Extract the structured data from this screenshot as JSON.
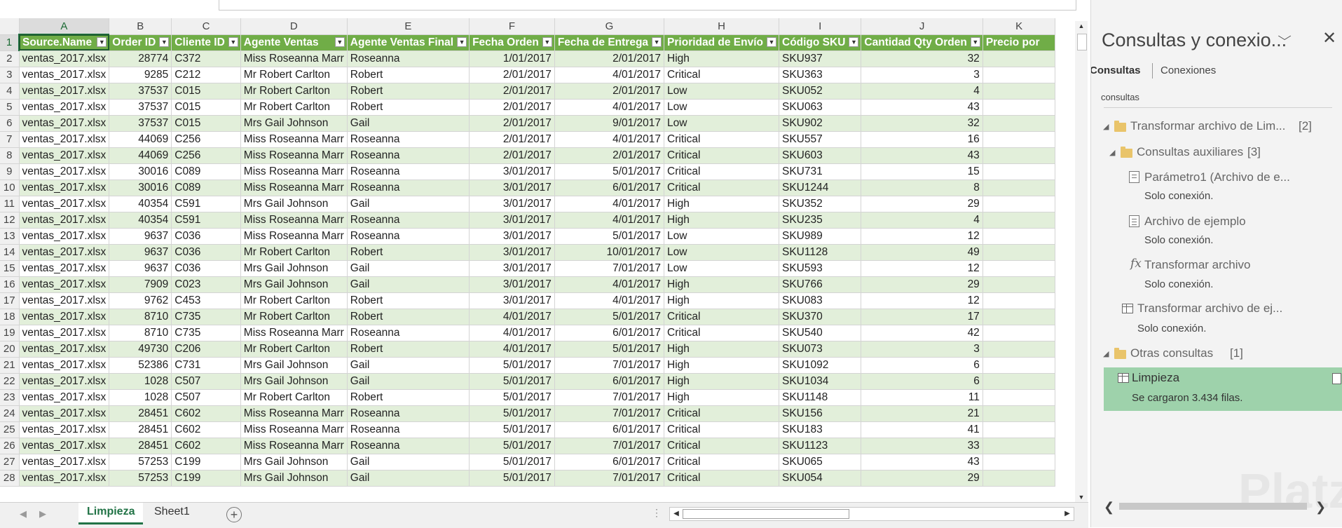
{
  "columns": [
    "A",
    "B",
    "C",
    "D",
    "E",
    "F",
    "G",
    "H",
    "I",
    "J",
    "K"
  ],
  "headers": [
    "Source.Name",
    "Order ID",
    "Cliente ID",
    "Agente Ventas",
    "Agente Ventas Final",
    "Fecha Orden",
    "Fecha de Entrega",
    "Prioridad de Envío",
    "Código SKU",
    "Cantidad Qty Orden",
    "Precio por"
  ],
  "rows": [
    [
      "ventas_2017.xlsx",
      "28774",
      "C372",
      "Miss Roseanna Marr",
      "Roseanna",
      "1/01/2017",
      "2/01/2017",
      "High",
      "SKU937",
      "32",
      ""
    ],
    [
      "ventas_2017.xlsx",
      "9285",
      "C212",
      "Mr Robert Carlton",
      "Robert",
      "2/01/2017",
      "4/01/2017",
      "Critical",
      "SKU363",
      "3",
      ""
    ],
    [
      "ventas_2017.xlsx",
      "37537",
      "C015",
      "Mr Robert Carlton",
      "Robert",
      "2/01/2017",
      "2/01/2017",
      "Low",
      "SKU052",
      "4",
      ""
    ],
    [
      "ventas_2017.xlsx",
      "37537",
      "C015",
      "Mr Robert Carlton",
      "Robert",
      "2/01/2017",
      "4/01/2017",
      "Low",
      "SKU063",
      "43",
      ""
    ],
    [
      "ventas_2017.xlsx",
      "37537",
      "C015",
      "Mrs Gail Johnson",
      "Gail",
      "2/01/2017",
      "9/01/2017",
      "Low",
      "SKU902",
      "32",
      ""
    ],
    [
      "ventas_2017.xlsx",
      "44069",
      "C256",
      "Miss Roseanna Marr",
      "Roseanna",
      "2/01/2017",
      "4/01/2017",
      "Critical",
      "SKU557",
      "16",
      ""
    ],
    [
      "ventas_2017.xlsx",
      "44069",
      "C256",
      "Miss Roseanna Marr",
      "Roseanna",
      "2/01/2017",
      "2/01/2017",
      "Critical",
      "SKU603",
      "43",
      ""
    ],
    [
      "ventas_2017.xlsx",
      "30016",
      "C089",
      "Miss Roseanna Marr",
      "Roseanna",
      "3/01/2017",
      "5/01/2017",
      "Critical",
      "SKU731",
      "15",
      ""
    ],
    [
      "ventas_2017.xlsx",
      "30016",
      "C089",
      "Miss Roseanna Marr",
      "Roseanna",
      "3/01/2017",
      "6/01/2017",
      "Critical",
      "SKU1244",
      "8",
      ""
    ],
    [
      "ventas_2017.xlsx",
      "40354",
      "C591",
      "Mrs Gail Johnson",
      "Gail",
      "3/01/2017",
      "4/01/2017",
      "High",
      "SKU352",
      "29",
      ""
    ],
    [
      "ventas_2017.xlsx",
      "40354",
      "C591",
      "Miss Roseanna Marr",
      "Roseanna",
      "3/01/2017",
      "4/01/2017",
      "High",
      "SKU235",
      "4",
      ""
    ],
    [
      "ventas_2017.xlsx",
      "9637",
      "C036",
      "Miss Roseanna Marr",
      "Roseanna",
      "3/01/2017",
      "5/01/2017",
      "Low",
      "SKU989",
      "12",
      ""
    ],
    [
      "ventas_2017.xlsx",
      "9637",
      "C036",
      "Mr Robert Carlton",
      "Robert",
      "3/01/2017",
      "10/01/2017",
      "Low",
      "SKU1128",
      "49",
      ""
    ],
    [
      "ventas_2017.xlsx",
      "9637",
      "C036",
      "Mrs Gail Johnson",
      "Gail",
      "3/01/2017",
      "7/01/2017",
      "Low",
      "SKU593",
      "12",
      ""
    ],
    [
      "ventas_2017.xlsx",
      "7909",
      "C023",
      "Mrs Gail Johnson",
      "Gail",
      "3/01/2017",
      "4/01/2017",
      "High",
      "SKU766",
      "29",
      ""
    ],
    [
      "ventas_2017.xlsx",
      "9762",
      "C453",
      "Mr Robert Carlton",
      "Robert",
      "3/01/2017",
      "4/01/2017",
      "High",
      "SKU083",
      "12",
      ""
    ],
    [
      "ventas_2017.xlsx",
      "8710",
      "C735",
      "Mr Robert Carlton",
      "Robert",
      "4/01/2017",
      "5/01/2017",
      "Critical",
      "SKU370",
      "17",
      ""
    ],
    [
      "ventas_2017.xlsx",
      "8710",
      "C735",
      "Miss Roseanna Marr",
      "Roseanna",
      "4/01/2017",
      "6/01/2017",
      "Critical",
      "SKU540",
      "42",
      ""
    ],
    [
      "ventas_2017.xlsx",
      "49730",
      "C206",
      "Mr Robert Carlton",
      "Robert",
      "4/01/2017",
      "5/01/2017",
      "High",
      "SKU073",
      "3",
      ""
    ],
    [
      "ventas_2017.xlsx",
      "52386",
      "C731",
      "Mrs Gail Johnson",
      "Gail",
      "5/01/2017",
      "7/01/2017",
      "High",
      "SKU1092",
      "6",
      ""
    ],
    [
      "ventas_2017.xlsx",
      "1028",
      "C507",
      "Mrs Gail Johnson",
      "Gail",
      "5/01/2017",
      "6/01/2017",
      "High",
      "SKU1034",
      "6",
      ""
    ],
    [
      "ventas_2017.xlsx",
      "1028",
      "C507",
      "Mr Robert Carlton",
      "Robert",
      "5/01/2017",
      "7/01/2017",
      "High",
      "SKU1148",
      "11",
      ""
    ],
    [
      "ventas_2017.xlsx",
      "28451",
      "C602",
      "Miss Roseanna Marr",
      "Roseanna",
      "5/01/2017",
      "7/01/2017",
      "Critical",
      "SKU156",
      "21",
      ""
    ],
    [
      "ventas_2017.xlsx",
      "28451",
      "C602",
      "Miss Roseanna Marr",
      "Roseanna",
      "5/01/2017",
      "6/01/2017",
      "Critical",
      "SKU183",
      "41",
      ""
    ],
    [
      "ventas_2017.xlsx",
      "28451",
      "C602",
      "Miss Roseanna Marr",
      "Roseanna",
      "5/01/2017",
      "7/01/2017",
      "Critical",
      "SKU1123",
      "33",
      ""
    ],
    [
      "ventas_2017.xlsx",
      "57253",
      "C199",
      "Mrs Gail Johnson",
      "Gail",
      "5/01/2017",
      "6/01/2017",
      "Critical",
      "SKU065",
      "43",
      ""
    ],
    [
      "ventas_2017.xlsx",
      "57253",
      "C199",
      "Mrs Gail Johnson",
      "Gail",
      "5/01/2017",
      "7/01/2017",
      "Critical",
      "SKU054",
      "29",
      ""
    ]
  ],
  "sheet_tabs": [
    "Limpieza",
    "Sheet1"
  ],
  "active_tab": "Limpieza",
  "pane": {
    "title": "Consultas y conexio...",
    "tabs": [
      "Consultas",
      "Conexiones"
    ],
    "count_label": "consultas",
    "groups": {
      "transformar": {
        "label": "Transformar archivo de Lim...",
        "count": "[2]"
      },
      "auxiliares": {
        "label": "Consultas auxiliares",
        "count": "[3]"
      },
      "otras": {
        "label": "Otras consultas",
        "count": "[1]"
      }
    },
    "items": [
      {
        "label": "Parámetro1 (Archivo de e...",
        "status": "Solo conexión.",
        "icon": "parameter-icon"
      },
      {
        "label": "Archivo de ejemplo",
        "status": "Solo conexión.",
        "icon": "document-icon"
      },
      {
        "label": "Transformar archivo",
        "status": "Solo conexión.",
        "icon": "function-icon"
      },
      {
        "label": "Transformar archivo de ej...",
        "status": "Solo conexión.",
        "icon": "table-icon"
      }
    ],
    "selected": {
      "label": "Limpieza",
      "status": "Se cargaron 3.434 filas.",
      "icon": "table-icon"
    },
    "watermark": "Platzi"
  },
  "colors": {
    "header_green": "#70ad47",
    "band_green": "#e2efda",
    "selected_query": "#9ed2ab",
    "accent": "#217346"
  }
}
